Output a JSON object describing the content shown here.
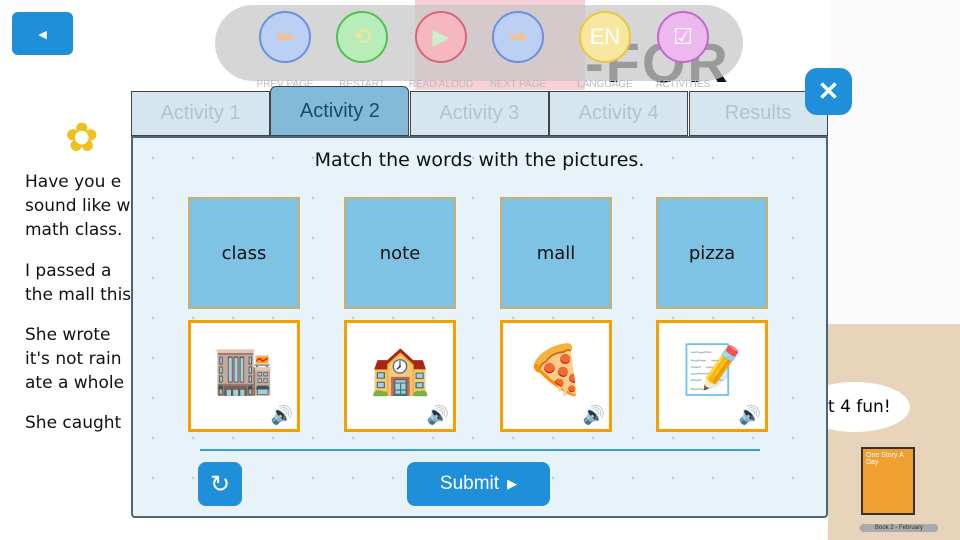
{
  "toolbar": {
    "back": "◄",
    "buttons": [
      {
        "label": "PREV PAGE",
        "icon": "arrow-left-icon",
        "glyph": "⬅",
        "bg": "#bcd0f4",
        "bd": "#6c8fe0",
        "fg": "#f5c28e"
      },
      {
        "label": "RESTART",
        "icon": "restart-icon",
        "glyph": "⟲",
        "bg": "#b8ecb8",
        "bd": "#4fc24f",
        "fg": "#f5e1a0"
      },
      {
        "label": "READ ALOUD",
        "icon": "play-icon",
        "glyph": "▶",
        "bg": "#f5b8c0",
        "bd": "#d9657a",
        "fg": "#cdeecd"
      },
      {
        "label": "NEXT PAGE",
        "icon": "arrow-right-icon",
        "glyph": "➡",
        "bg": "#bcd0f4",
        "bd": "#6c8fe0",
        "fg": "#f5c28e"
      },
      {
        "label": "LANGUAGE",
        "icon": "uk-flag-icon",
        "glyph": "EN",
        "bg": "#f8e7a0",
        "bd": "#e8c840",
        "fg": "#fff"
      },
      {
        "label": "ACTIVITIES",
        "icon": "activities-icon",
        "glyph": "☑",
        "bg": "#ecb8ee",
        "bd": "#c566d0",
        "fg": "#fff"
      }
    ]
  },
  "page": {
    "heading": "-FOR",
    "lines": [
      "Have you e\nsound like w\nmath class.",
      "I passed a\nthe mall this",
      "She wrote\nit's not rain\nate a whole",
      "She caught"
    ],
    "bubble": "t 4 fun!",
    "book_title": "One Story A Day",
    "footer": "Book 2 - February"
  },
  "dialog": {
    "tabs": [
      "Activity 1",
      "Activity 2",
      "Activity 3",
      "Activity 4",
      "Results"
    ],
    "active_tab": 1,
    "title": "Match the words with the pictures.",
    "words": [
      "class",
      "note",
      "mall",
      "pizza"
    ],
    "pictures": [
      "mall-picture",
      "classroom-picture",
      "pizza-picture",
      "note-picture"
    ],
    "submit": "Submit",
    "close": "✕",
    "reset": "↻"
  },
  "colors": {
    "accent": "#1e8fd8",
    "word_card": "#7fc3e4",
    "picture_border": "#f5a000"
  }
}
